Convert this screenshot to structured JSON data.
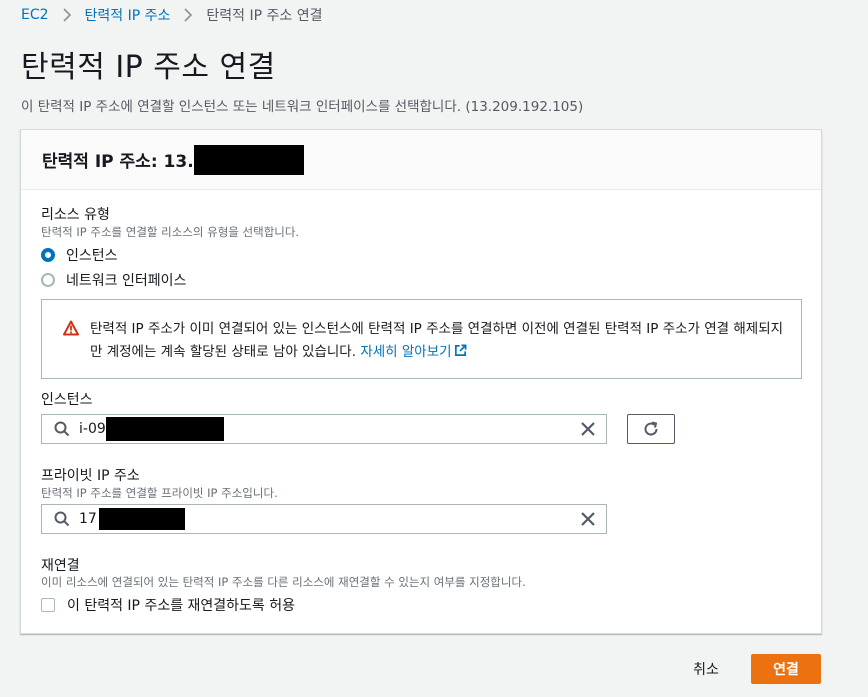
{
  "breadcrumb": {
    "items": [
      "EC2",
      "탄력적 IP 주소",
      "탄력적 IP 주소 연결"
    ]
  },
  "page": {
    "title": "탄력적 IP 주소 연결",
    "description": "이 탄력적 IP 주소에 연결할 인스턴스 또는 네트워크 인터페이스를 선택합니다. (13.209.192.105)"
  },
  "panel": {
    "title_prefix": "탄력적 IP 주소: 13."
  },
  "resource_type": {
    "label": "리소스 유형",
    "description": "탄력적 IP 주소를 연결할 리소스의 유형을 선택합니다.",
    "options": [
      "인스턴스",
      "네트워크 인터페이스"
    ],
    "selected": "인스턴스"
  },
  "warning": {
    "text": "탄력적 IP 주소가 이미 연결되어 있는 인스턴스에 탄력적 IP 주소를 연결하면 이전에 연결된 탄력적 IP 주소가 연결 해제되지만 계정에는 계속 할당된 상태로 남아 있습니다.",
    "link": "자세히 알아보기"
  },
  "instance": {
    "label": "인스턴스",
    "value_prefix": "i-09"
  },
  "private_ip": {
    "label": "프라이빗 IP 주소",
    "description": "탄력적 IP 주소를 연결할 프라이빗 IP 주소입니다.",
    "value_prefix": "17"
  },
  "reassociate": {
    "label": "재연결",
    "description": "이미 리소스에 연결되어 있는 탄력적 IP 주소를 다른 리소스에 재연결할 수 있는지 여부를 지정합니다.",
    "checkbox_label": "이 탄력적 IP 주소를 재연결하도록 허용",
    "checked": false
  },
  "actions": {
    "cancel": "취소",
    "submit": "연결"
  },
  "colors": {
    "link": "#0073bb",
    "primary": "#ec7211",
    "warning": "#d13212"
  }
}
